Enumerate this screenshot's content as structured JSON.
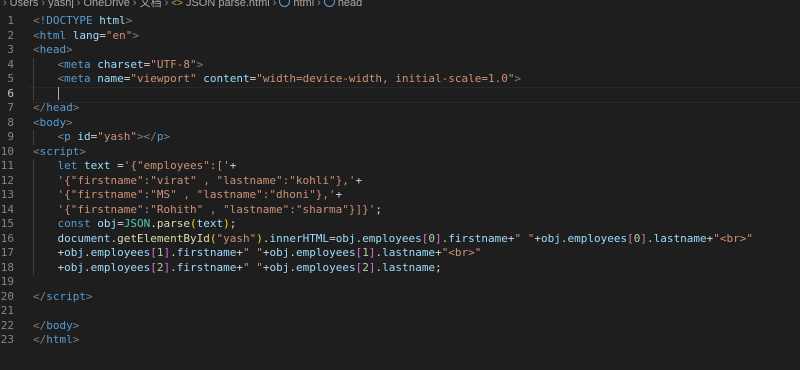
{
  "breadcrumb": {
    "items": [
      {
        "label": "Users",
        "icon": null
      },
      {
        "label": "yashj",
        "icon": null
      },
      {
        "label": "OneDrive",
        "icon": null
      },
      {
        "label": "文档",
        "icon": null
      },
      {
        "label": "JSON parse.html",
        "icon": "json-file-icon"
      },
      {
        "label": "html",
        "icon": "html-element-icon"
      },
      {
        "label": "head",
        "icon": "html-element-icon"
      }
    ]
  },
  "editor": {
    "active_line": 6,
    "lines": [
      {
        "n": "1",
        "indent": 0,
        "tokens": [
          [
            "t-br",
            "<!"
          ],
          [
            "t-tag",
            "DOCTYPE"
          ],
          [
            "t-txt",
            " "
          ],
          [
            "t-attr",
            "html"
          ],
          [
            "t-br",
            ">"
          ]
        ]
      },
      {
        "n": "2",
        "indent": 0,
        "tokens": [
          [
            "t-br",
            "<"
          ],
          [
            "t-tag",
            "html"
          ],
          [
            "t-txt",
            " "
          ],
          [
            "t-attr",
            "lang"
          ],
          [
            "t-txt",
            "="
          ],
          [
            "t-str",
            "\"en\""
          ],
          [
            "t-br",
            ">"
          ]
        ]
      },
      {
        "n": "3",
        "indent": 0,
        "tokens": [
          [
            "t-br",
            "<"
          ],
          [
            "t-tag",
            "head"
          ],
          [
            "t-br",
            ">"
          ]
        ]
      },
      {
        "n": "4",
        "indent": 1,
        "tokens": [
          [
            "t-br",
            "<"
          ],
          [
            "t-tag",
            "meta"
          ],
          [
            "t-txt",
            " "
          ],
          [
            "t-attr",
            "charset"
          ],
          [
            "t-txt",
            "="
          ],
          [
            "t-str",
            "\"UTF-8\""
          ],
          [
            "t-br",
            ">"
          ]
        ]
      },
      {
        "n": "5",
        "indent": 1,
        "tokens": [
          [
            "t-br",
            "<"
          ],
          [
            "t-tag",
            "meta"
          ],
          [
            "t-txt",
            " "
          ],
          [
            "t-attr",
            "name"
          ],
          [
            "t-txt",
            "="
          ],
          [
            "t-str",
            "\"viewport\""
          ],
          [
            "t-txt",
            " "
          ],
          [
            "t-attr",
            "content"
          ],
          [
            "t-txt",
            "="
          ],
          [
            "t-str",
            "\"width=device-width, initial-scale=1.0\""
          ],
          [
            "t-br",
            ">"
          ]
        ]
      },
      {
        "n": "6",
        "indent": 1,
        "tokens": []
      },
      {
        "n": "7",
        "indent": 0,
        "tokens": [
          [
            "t-br",
            "</"
          ],
          [
            "t-tag",
            "head"
          ],
          [
            "t-br",
            ">"
          ]
        ]
      },
      {
        "n": "8",
        "indent": 0,
        "tokens": [
          [
            "t-br",
            "<"
          ],
          [
            "t-tag",
            "body"
          ],
          [
            "t-br",
            ">"
          ]
        ]
      },
      {
        "n": "9",
        "indent": 1,
        "tokens": [
          [
            "t-br",
            "<"
          ],
          [
            "t-tag",
            "p"
          ],
          [
            "t-txt",
            " "
          ],
          [
            "t-attr",
            "id"
          ],
          [
            "t-txt",
            "="
          ],
          [
            "t-str",
            "\"yash\""
          ],
          [
            "t-br",
            "></"
          ],
          [
            "t-tag",
            "p"
          ],
          [
            "t-br",
            ">"
          ]
        ]
      },
      {
        "n": "10",
        "indent": 0,
        "tokens": [
          [
            "t-br",
            "<"
          ],
          [
            "t-tag",
            "script"
          ],
          [
            "t-br",
            ">"
          ]
        ]
      },
      {
        "n": "11",
        "indent": 1,
        "tokens": [
          [
            "t-kw",
            "let"
          ],
          [
            "t-txt",
            " "
          ],
          [
            "t-var",
            "text"
          ],
          [
            "t-txt",
            " ="
          ],
          [
            "t-str",
            "'{\"employees\":['"
          ],
          [
            "t-txt",
            "+"
          ]
        ]
      },
      {
        "n": "12",
        "indent": 1,
        "tokens": [
          [
            "t-str",
            "'{\"firstname\":\"virat\" , \"lastname\":\"kohli\"},'"
          ],
          [
            "t-txt",
            "+"
          ]
        ]
      },
      {
        "n": "13",
        "indent": 1,
        "tokens": [
          [
            "t-str",
            "'{\"firstname\":\"MS\" , \"lastname\":\"dhoni\"},'"
          ],
          [
            "t-txt",
            "+"
          ]
        ]
      },
      {
        "n": "14",
        "indent": 1,
        "tokens": [
          [
            "t-str",
            "'{\"firstname\":\"Rohith\" , \"lastname\":\"sharma\"}]}'"
          ],
          [
            "t-txt",
            ";"
          ]
        ]
      },
      {
        "n": "15",
        "indent": 1,
        "tokens": [
          [
            "t-kw",
            "const"
          ],
          [
            "t-txt",
            " "
          ],
          [
            "t-var",
            "obj"
          ],
          [
            "t-txt",
            "="
          ],
          [
            "t-obj",
            "JSON"
          ],
          [
            "t-txt",
            "."
          ],
          [
            "t-fn",
            "parse"
          ],
          [
            "t-bk",
            "("
          ],
          [
            "t-var",
            "text"
          ],
          [
            "t-bk",
            ")"
          ],
          [
            "t-txt",
            ";"
          ]
        ]
      },
      {
        "n": "16",
        "indent": 1,
        "tokens": [
          [
            "t-var",
            "document"
          ],
          [
            "t-txt",
            "."
          ],
          [
            "t-fn",
            "getElementById"
          ],
          [
            "t-bk",
            "("
          ],
          [
            "t-str",
            "\"yash\""
          ],
          [
            "t-bk",
            ")"
          ],
          [
            "t-txt",
            "."
          ],
          [
            "t-var",
            "innerHTML"
          ],
          [
            "t-txt",
            "="
          ],
          [
            "t-var",
            "obj"
          ],
          [
            "t-txt",
            "."
          ],
          [
            "t-var",
            "employees"
          ],
          [
            "t-bk2",
            "["
          ],
          [
            "t-num",
            "0"
          ],
          [
            "t-bk2",
            "]"
          ],
          [
            "t-txt",
            "."
          ],
          [
            "t-var",
            "firstname"
          ],
          [
            "t-txt",
            "+"
          ],
          [
            "t-str",
            "\" \""
          ],
          [
            "t-txt",
            "+"
          ],
          [
            "t-var",
            "obj"
          ],
          [
            "t-txt",
            "."
          ],
          [
            "t-var",
            "employees"
          ],
          [
            "t-bk2",
            "["
          ],
          [
            "t-num",
            "0"
          ],
          [
            "t-bk2",
            "]"
          ],
          [
            "t-txt",
            "."
          ],
          [
            "t-var",
            "lastname"
          ],
          [
            "t-txt",
            "+"
          ],
          [
            "t-str",
            "\"<br>\""
          ]
        ]
      },
      {
        "n": "17",
        "indent": 1,
        "tokens": [
          [
            "t-txt",
            "+"
          ],
          [
            "t-var",
            "obj"
          ],
          [
            "t-txt",
            "."
          ],
          [
            "t-var",
            "employees"
          ],
          [
            "t-bk2",
            "["
          ],
          [
            "t-num",
            "1"
          ],
          [
            "t-bk2",
            "]"
          ],
          [
            "t-txt",
            "."
          ],
          [
            "t-var",
            "firstname"
          ],
          [
            "t-txt",
            "+"
          ],
          [
            "t-str",
            "\" \""
          ],
          [
            "t-txt",
            "+"
          ],
          [
            "t-var",
            "obj"
          ],
          [
            "t-txt",
            "."
          ],
          [
            "t-var",
            "employees"
          ],
          [
            "t-bk2",
            "["
          ],
          [
            "t-num",
            "1"
          ],
          [
            "t-bk2",
            "]"
          ],
          [
            "t-txt",
            "."
          ],
          [
            "t-var",
            "lastname"
          ],
          [
            "t-txt",
            "+"
          ],
          [
            "t-str",
            "\"<br>\""
          ]
        ]
      },
      {
        "n": "18",
        "indent": 1,
        "tokens": [
          [
            "t-txt",
            "+"
          ],
          [
            "t-var",
            "obj"
          ],
          [
            "t-txt",
            "."
          ],
          [
            "t-var",
            "employees"
          ],
          [
            "t-bk2",
            "["
          ],
          [
            "t-num",
            "2"
          ],
          [
            "t-bk2",
            "]"
          ],
          [
            "t-txt",
            "."
          ],
          [
            "t-var",
            "firstname"
          ],
          [
            "t-txt",
            "+"
          ],
          [
            "t-str",
            "\" \""
          ],
          [
            "t-txt",
            "+"
          ],
          [
            "t-var",
            "obj"
          ],
          [
            "t-txt",
            "."
          ],
          [
            "t-var",
            "employees"
          ],
          [
            "t-bk2",
            "["
          ],
          [
            "t-num",
            "2"
          ],
          [
            "t-bk2",
            "]"
          ],
          [
            "t-txt",
            "."
          ],
          [
            "t-var",
            "lastname"
          ],
          [
            "t-txt",
            ";"
          ]
        ]
      },
      {
        "n": "19",
        "indent": 0,
        "tokens": []
      },
      {
        "n": "20",
        "indent": 0,
        "tokens": [
          [
            "t-br",
            "</"
          ],
          [
            "t-tag",
            "script"
          ],
          [
            "t-br",
            ">"
          ]
        ]
      },
      {
        "n": "21",
        "indent": 0,
        "tokens": []
      },
      {
        "n": "22",
        "indent": 0,
        "tokens": [
          [
            "t-br",
            "</"
          ],
          [
            "t-tag",
            "body"
          ],
          [
            "t-br",
            ">"
          ]
        ]
      },
      {
        "n": "23",
        "indent": 0,
        "tokens": [
          [
            "t-br",
            "</"
          ],
          [
            "t-tag",
            "html"
          ],
          [
            "t-br",
            ">"
          ]
        ]
      }
    ]
  },
  "colors": {
    "background": "#1e1e1e",
    "tag": "#569cd6",
    "attribute": "#9cdcfe",
    "string": "#ce9178",
    "function": "#dcdcaa",
    "class": "#4ec9b0",
    "number": "#b5cea8"
  }
}
